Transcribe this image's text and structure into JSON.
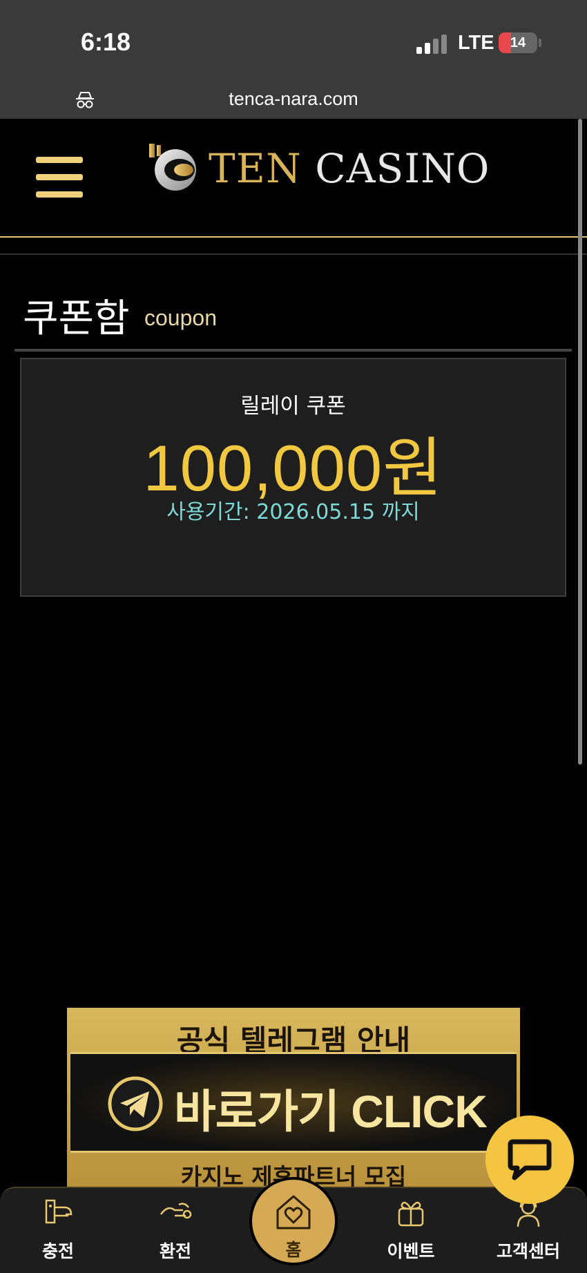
{
  "status_bar": {
    "time": "6:18",
    "network": "LTE",
    "battery": "14",
    "battery_level_percent": 14
  },
  "browser": {
    "url": "tenca-nara.com",
    "incognito_icon": "incognito-icon"
  },
  "header": {
    "logo_word1": "TEN",
    "logo_word2": "CASINO",
    "menu_icon": "hamburger-icon"
  },
  "page": {
    "title": "쿠폰함",
    "subtitle": "coupon"
  },
  "coupon": {
    "name": "릴레이 쿠폰",
    "amount": "100,000원",
    "expiry": "사용기간: 2026.05.15 까지"
  },
  "banner": {
    "top_text": "공식 텔레그램 안내",
    "main_text": "바로가기 CLICK",
    "bottom_text": "카지노 제휴파트너 모집"
  },
  "nav": {
    "items": [
      {
        "label": "충전",
        "icon": "deposit-icon"
      },
      {
        "label": "환전",
        "icon": "withdraw-icon"
      },
      {
        "label": "홈",
        "icon": "home-heart-icon"
      },
      {
        "label": "이벤트",
        "icon": "gift-icon"
      },
      {
        "label": "고객센터",
        "icon": "support-icon"
      }
    ]
  },
  "colors": {
    "accent_gold": "#f2c840",
    "expiry_teal": "#7ddad8",
    "chat_yellow": "#f5c542"
  }
}
